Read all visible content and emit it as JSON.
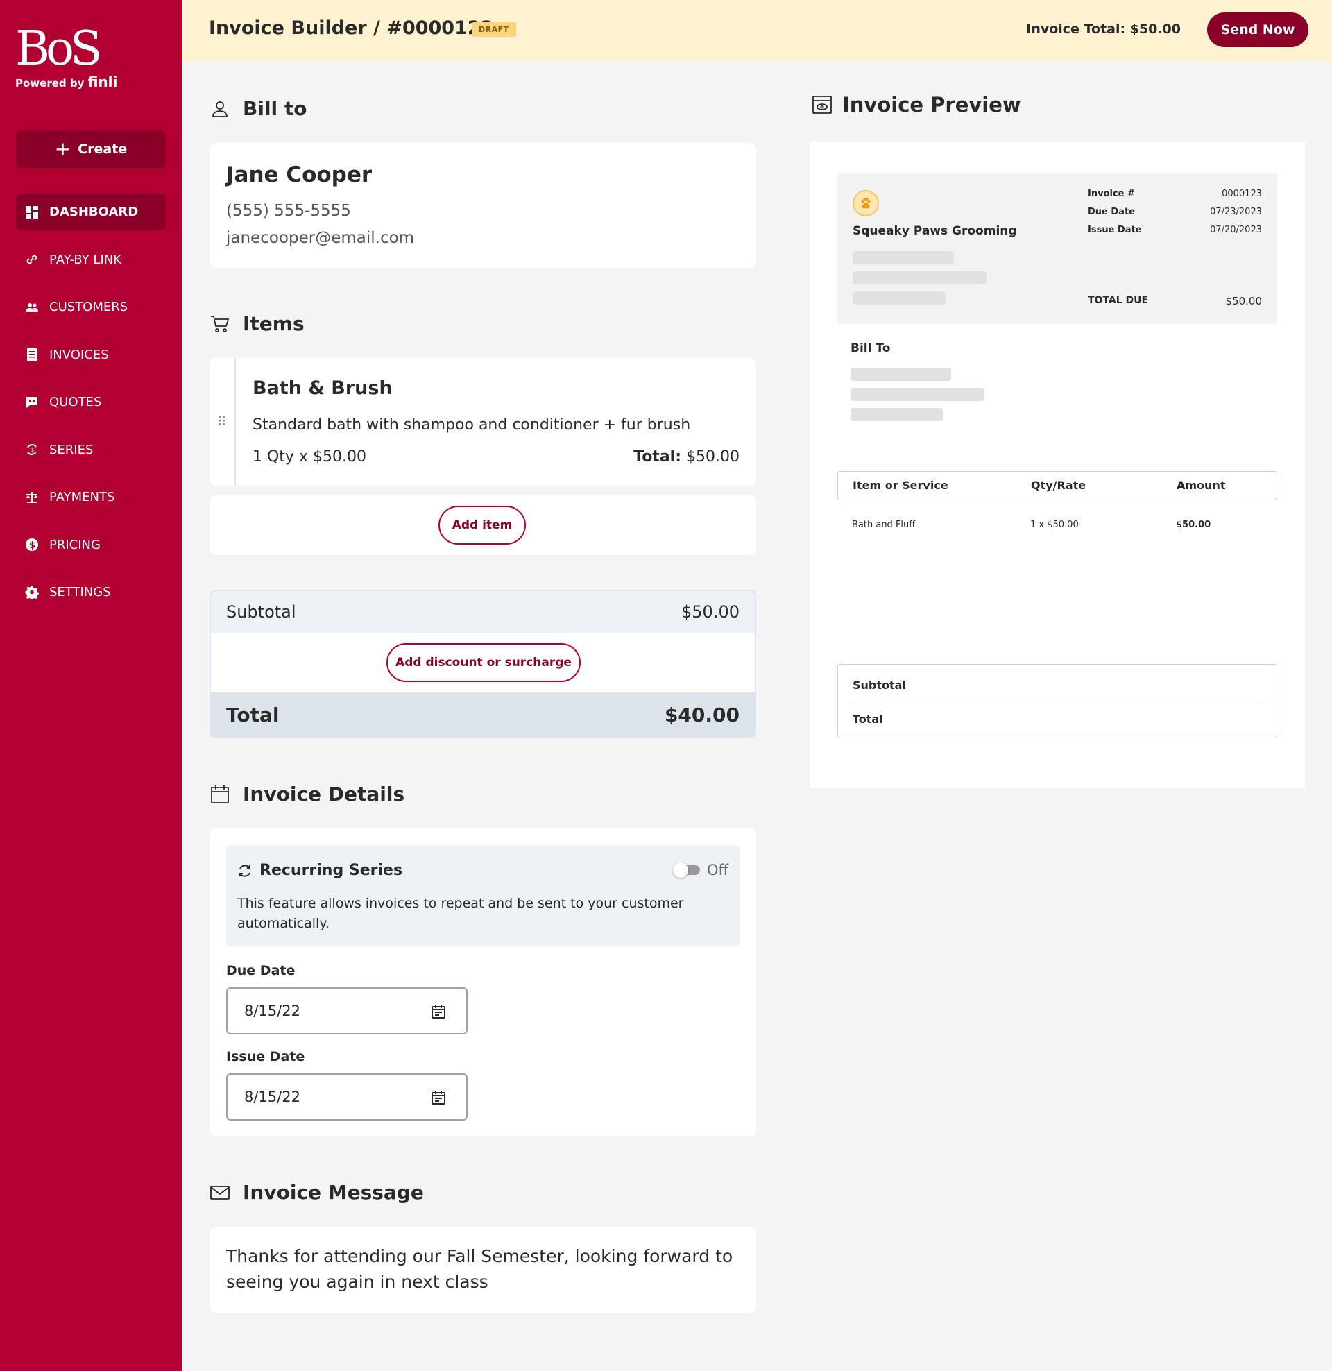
{
  "brand": {
    "logo_text": "BoS",
    "powered_by": "Powered by",
    "powered_brand": "finli"
  },
  "sidebar": {
    "create_label": "Create",
    "items": [
      {
        "label": "DASHBOARD",
        "icon": "dashboard-icon",
        "active": true
      },
      {
        "label": "PAY-BY LINK",
        "icon": "link-icon"
      },
      {
        "label": "CUSTOMERS",
        "icon": "people-icon"
      },
      {
        "label": "INVOICES",
        "icon": "document-icon"
      },
      {
        "label": "QUOTES",
        "icon": "quote-icon"
      },
      {
        "label": "SERIES",
        "icon": "series-icon"
      },
      {
        "label": "PAYMENTS",
        "icon": "scale-icon"
      },
      {
        "label": "PRICING",
        "icon": "dollar-icon"
      },
      {
        "label": "SETTINGS",
        "icon": "gear-icon"
      }
    ]
  },
  "header": {
    "title": "Invoice Builder / #0000123",
    "badge": "DRAFT",
    "invoice_total": "Invoice Total: $50.00",
    "send_label": "Send Now"
  },
  "bill_to": {
    "heading": "Bill to",
    "name": "Jane Cooper",
    "phone": "(555) 555-5555",
    "email": "janecooper@email.com"
  },
  "items": {
    "heading": "Items",
    "list": [
      {
        "name": "Bath & Brush",
        "description": "Standard bath with shampoo and conditioner + fur brush",
        "qty_rate": "1 Qty x $50.00",
        "total_label": "Total:",
        "total_value": "$50.00"
      }
    ],
    "add_item_label": "Add item"
  },
  "totals": {
    "subtotal_label": "Subtotal",
    "subtotal_value": "$50.00",
    "add_discount_label": "Add discount or surcharge",
    "total_label": "Total",
    "total_value": "$40.00"
  },
  "details": {
    "heading": "Invoice Details",
    "recurring_title": "Recurring Series",
    "recurring_state": "Off",
    "recurring_enabled": false,
    "recurring_desc": "This feature allows invoices to repeat and be sent to your customer automatically.",
    "due_date_label": "Due Date",
    "due_date_value": "8/15/22",
    "issue_date_label": "Issue Date",
    "issue_date_value": "8/15/22"
  },
  "message": {
    "heading": "Invoice Message",
    "text": "Thanks for attending our Fall Semester, looking forward to seeing you again in next class"
  },
  "preview": {
    "heading": "Invoice Preview",
    "business_name": "Squeaky Paws Grooming",
    "meta": [
      {
        "label": "Invoice #",
        "value": "0000123"
      },
      {
        "label": "Due Date",
        "value": "07/23/2023"
      },
      {
        "label": "Issue Date",
        "value": "07/20/2023"
      }
    ],
    "total_due_label": "TOTAL DUE",
    "total_due_value": "$50.00",
    "bill_to_label": "Bill To",
    "table_headers": {
      "item": "Item or Service",
      "qty": "Qty/Rate",
      "amount": "Amount"
    },
    "rows": [
      {
        "item": "Bath and Fluff",
        "qty": "1 x $50.00",
        "amount": "$50.00"
      }
    ],
    "subtotal_label": "Subtotal",
    "total_label": "Total"
  },
  "colors": {
    "brand": "#b20033",
    "brand_dark": "#8a0028",
    "header_bg": "#fff2d1",
    "draft_badge": "#fbd37f"
  }
}
